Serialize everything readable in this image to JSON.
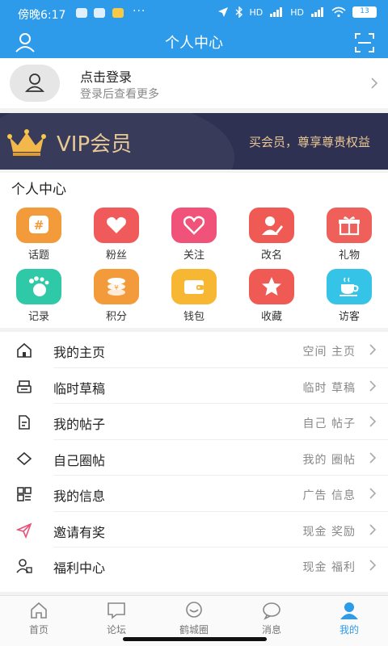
{
  "status_bar": {
    "time": "傍晚6:17",
    "more": "···",
    "network": "HD",
    "battery": "13"
  },
  "header": {
    "title": "个人中心"
  },
  "login": {
    "title": "点击登录",
    "subtitle": "登录后查看更多"
  },
  "vip": {
    "label": "VIP会员",
    "slogan": "买会员，尊享尊贵权益"
  },
  "personal_center": {
    "heading": "个人中心",
    "items": [
      {
        "label": "话题",
        "icon": "hash-icon",
        "color": "#f39b3a"
      },
      {
        "label": "粉丝",
        "icon": "heart-plus-icon",
        "color": "#f15a5a"
      },
      {
        "label": "关注",
        "icon": "heart-icon",
        "color": "#f1527a"
      },
      {
        "label": "改名",
        "icon": "edit-user-icon",
        "color": "#ef5a55"
      },
      {
        "label": "礼物",
        "icon": "gift-icon",
        "color": "#f0605a"
      },
      {
        "label": "记录",
        "icon": "footprint-icon",
        "color": "#2fc9a8"
      },
      {
        "label": "积分",
        "icon": "coins-icon",
        "color": "#f39b3a"
      },
      {
        "label": "钱包",
        "icon": "wallet-icon",
        "color": "#f7b733"
      },
      {
        "label": "收藏",
        "icon": "star-icon",
        "color": "#ef5a55"
      },
      {
        "label": "访客",
        "icon": "cup-icon",
        "color": "#36c3e8"
      }
    ]
  },
  "menu": [
    {
      "title": "我的主页",
      "extra": "空间 主页",
      "icon": "home-icon"
    },
    {
      "title": "临时草稿",
      "extra": "临时 草稿",
      "icon": "printer-icon"
    },
    {
      "title": "我的帖子",
      "extra": "自己 帖子",
      "icon": "document-icon"
    },
    {
      "title": "自己圈帖",
      "extra": "我的 圈帖",
      "icon": "diamond-icon"
    },
    {
      "title": "我的信息",
      "extra": "广告 信息",
      "icon": "grid-icon"
    },
    {
      "title": "邀请有奖",
      "extra": "现金 奖励",
      "icon": "send-icon"
    },
    {
      "title": "福利中心",
      "extra": "现金 福利",
      "icon": "user-gift-icon"
    }
  ],
  "tabbar": [
    {
      "label": "首页",
      "icon": "home-icon",
      "active": false
    },
    {
      "label": "论坛",
      "icon": "forum-icon",
      "active": false
    },
    {
      "label": "鹤城圈",
      "icon": "circle-chat-icon",
      "active": false
    },
    {
      "label": "消息",
      "icon": "message-icon",
      "active": false
    },
    {
      "label": "我的",
      "icon": "person-icon",
      "active": true
    }
  ],
  "colors": {
    "brand": "#2d9bea",
    "vip_bg": "#2f3152",
    "vip_gold": "#e8c894"
  }
}
